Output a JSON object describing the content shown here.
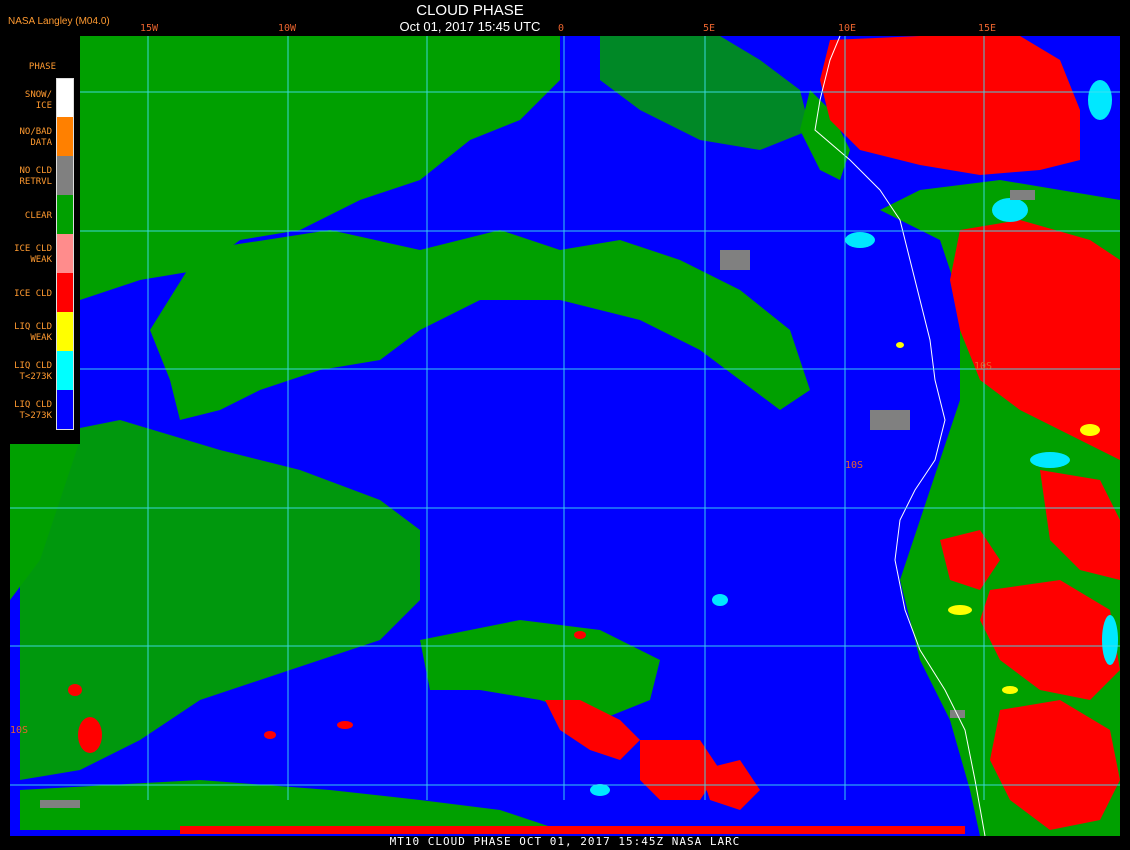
{
  "header": {
    "title": "CLOUD PHASE",
    "subtitle": "Oct 01, 2017 15:45 UTC",
    "source": "NASA Langley (M04.0)"
  },
  "footer": {
    "text": "MT10  CLOUD PHASE  OCT 01, 2017 15:45Z  NASA LARC"
  },
  "longitude_labels": [
    "15W",
    "10W",
    "0",
    "5E",
    "10E",
    "15E"
  ],
  "latitude_labels": [
    "10S",
    "10S",
    "10S"
  ],
  "legend": {
    "heading": "PHASE",
    "items": [
      {
        "label": "SNOW/\nICE",
        "color": "#ffffff"
      },
      {
        "label": "NO/BAD\nDATA",
        "color": "#ff8000"
      },
      {
        "label": "NO CLD\nRETRVL",
        "color": "#808080"
      },
      {
        "label": "CLEAR",
        "color": "#00a000"
      },
      {
        "label": "ICE CLD\nWEAK",
        "color": "#ff8c8c"
      },
      {
        "label": "ICE CLD",
        "color": "#ff0000"
      },
      {
        "label": "LIQ CLD\nWEAK",
        "color": "#ffff00"
      },
      {
        "label": "LIQ CLD\nT<273K",
        "color": "#00ffff"
      },
      {
        "label": "LIQ CLD\nT>273K",
        "color": "#0000ff"
      }
    ]
  },
  "colors": {
    "ocean_liquid": "#0000ff",
    "clear": "#00a000",
    "ice": "#ff0000",
    "grid": "#40e0f0",
    "coast": "#ffffff"
  }
}
